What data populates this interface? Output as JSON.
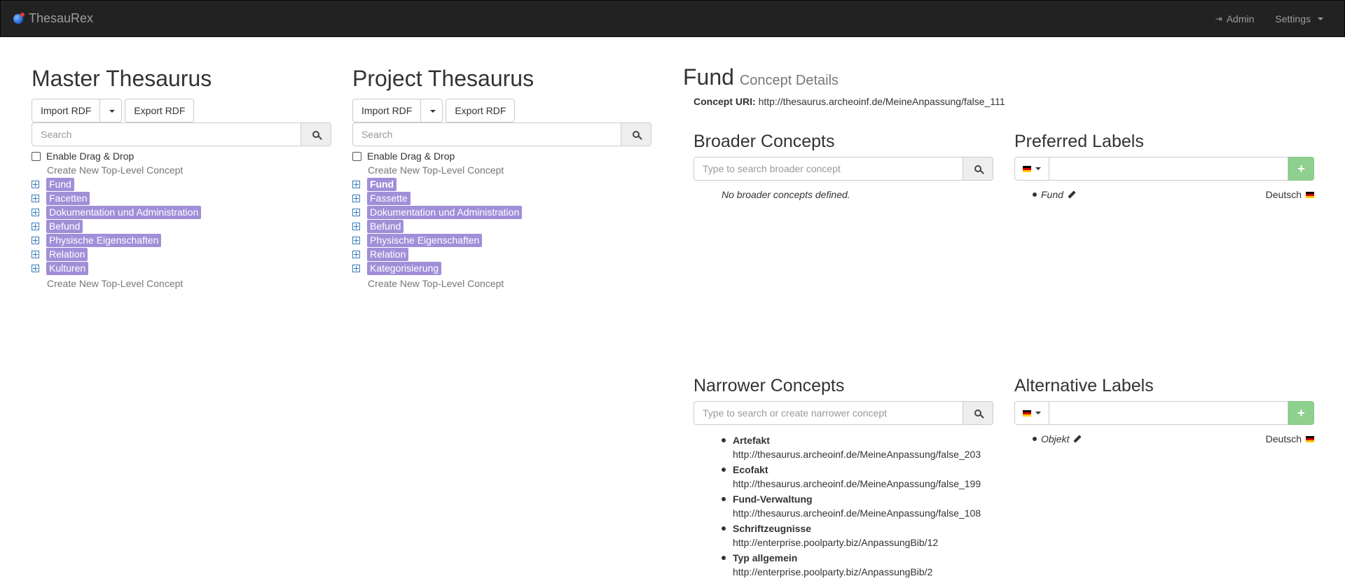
{
  "navbar": {
    "brand": "ThesauRex",
    "admin": "Admin",
    "settings": "Settings"
  },
  "master": {
    "title": "Master Thesaurus",
    "import_label": "Import RDF",
    "export_label": "Export RDF",
    "search_placeholder": "Search",
    "drag_drop_label": "Enable Drag & Drop",
    "create_top": "Create New Top-Level Concept",
    "create_bottom": "Create New Top-Level Concept",
    "concepts": [
      "Fund",
      "Facetten",
      "Dokumentation und Administration",
      "Befund",
      "Physische Eigenschaften",
      "Relation",
      "Kulturen"
    ]
  },
  "project": {
    "title": "Project Thesaurus",
    "import_label": "Import RDF",
    "export_label": "Export RDF",
    "search_placeholder": "Search",
    "drag_drop_label": "Enable Drag & Drop",
    "create_top": "Create New Top-Level Concept",
    "create_bottom": "Create New Top-Level Concept",
    "concepts": [
      "Fund",
      "Fassette",
      "Dokumentation und Administration",
      "Befund",
      "Physische Eigenschaften",
      "Relation",
      "Kategorisierung"
    ],
    "selected": "Fund"
  },
  "details": {
    "title": "Fund",
    "subtitle": "Concept Details",
    "uri_label": "Concept URI:",
    "uri": "http://thesaurus.archeoinf.de/MeineAnpassung/false_111",
    "broader": {
      "title": "Broader Concepts",
      "placeholder": "Type to search broader concept",
      "empty": "No broader concepts defined."
    },
    "preferred": {
      "title": "Preferred Labels",
      "add": "+",
      "labels": [
        {
          "text": "Fund",
          "lang": "Deutsch"
        }
      ]
    },
    "narrower": {
      "title": "Narrower Concepts",
      "placeholder": "Type to search or create narrower concept",
      "items": [
        {
          "name": "Artefakt",
          "uri": "http://thesaurus.archeoinf.de/MeineAnpassung/false_203"
        },
        {
          "name": "Ecofakt",
          "uri": "http://thesaurus.archeoinf.de/MeineAnpassung/false_199"
        },
        {
          "name": "Fund-Verwaltung",
          "uri": "http://thesaurus.archeoinf.de/MeineAnpassung/false_108"
        },
        {
          "name": "Schriftzeugnisse",
          "uri": "http://enterprise.poolparty.biz/AnpassungBib/12"
        },
        {
          "name": "Typ allgemein",
          "uri": "http://enterprise.poolparty.biz/AnpassungBib/2"
        }
      ]
    },
    "alternative": {
      "title": "Alternative Labels",
      "add": "+",
      "labels": [
        {
          "text": "Objekt",
          "lang": "Deutsch"
        }
      ]
    }
  }
}
